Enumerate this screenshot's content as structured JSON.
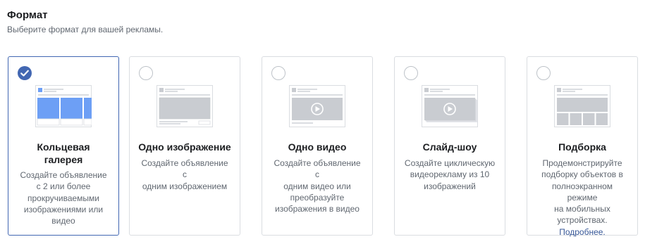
{
  "header": {
    "title": "Формат",
    "subtitle": "Выберите формат для вашей рекламы."
  },
  "cards": [
    {
      "title_line1": "Кольцевая",
      "title_line2": "галерея",
      "desc": [
        "Создайте объявление",
        "с 2 или более",
        "прокручиваемыми",
        "изображениями или",
        "видео"
      ],
      "selected": true
    },
    {
      "title_line1": "Одно изображение",
      "desc": [
        "Создайте объявление с",
        "одним изображением"
      ],
      "selected": false
    },
    {
      "title_line1": "Одно видео",
      "desc": [
        "Создайте объявление с",
        "одним видео или",
        "преобразуйте",
        "изображения в видео"
      ],
      "selected": false
    },
    {
      "title_line1": "Слайд-шоу",
      "desc": [
        "Создайте циклическую",
        "видеорекламу из 10",
        "изображений"
      ],
      "selected": false
    },
    {
      "title_line1": "Подборка",
      "desc": [
        "Продемонстрируйте",
        "подборку объектов в",
        "полноэкранном режиме",
        "на мобильных",
        "устройствах."
      ],
      "link": "Подробнее.",
      "selected": false
    }
  ],
  "colors": {
    "accent": "#4267b2",
    "carousel_fill": "#6d9ff5",
    "placeholder": "#c9ccd1",
    "link": "#385898"
  },
  "icons": {
    "selected": "check-circle-icon",
    "unselected": "radio-icon",
    "play": "play-icon"
  }
}
